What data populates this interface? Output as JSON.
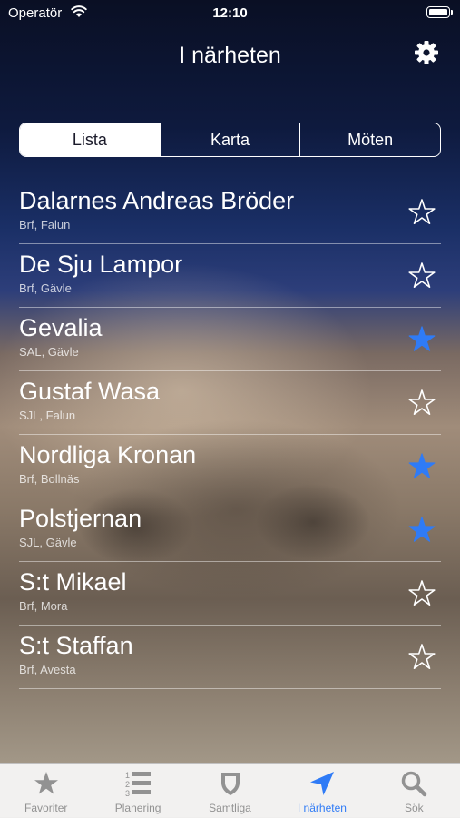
{
  "status_bar": {
    "carrier": "Operatör",
    "time": "12:10"
  },
  "nav": {
    "title": "I närheten",
    "settings_icon": "gear-icon"
  },
  "segments": [
    {
      "label": "Lista",
      "selected": true
    },
    {
      "label": "Karta",
      "selected": false
    },
    {
      "label": "Möten",
      "selected": false
    }
  ],
  "lodges": [
    {
      "name": "Dalarnes Andreas Bröder",
      "subtitle": "Brf, Falun",
      "favorite": false
    },
    {
      "name": "De Sju Lampor",
      "subtitle": "Brf, Gävle",
      "favorite": false
    },
    {
      "name": "Gevalia",
      "subtitle": "SAL, Gävle",
      "favorite": true
    },
    {
      "name": "Gustaf Wasa",
      "subtitle": "SJL, Falun",
      "favorite": false
    },
    {
      "name": "Nordliga Kronan",
      "subtitle": "Brf, Bollnäs",
      "favorite": true
    },
    {
      "name": "Polstjernan",
      "subtitle": "SJL, Gävle",
      "favorite": true
    },
    {
      "name": "S:t Mikael",
      "subtitle": "Brf, Mora",
      "favorite": false
    },
    {
      "name": "S:t Staffan",
      "subtitle": "Brf, Avesta",
      "favorite": false
    }
  ],
  "tabbar": {
    "tabs": [
      {
        "label": "Favoriter",
        "icon": "star-icon",
        "active": false
      },
      {
        "label": "Planering",
        "icon": "numbered-list-icon",
        "active": false
      },
      {
        "label": "Samtliga",
        "icon": "shield-icon",
        "active": false
      },
      {
        "label": "I närheten",
        "icon": "location-arrow-icon",
        "active": true
      },
      {
        "label": "Sök",
        "icon": "search-icon",
        "active": false
      }
    ]
  },
  "colors": {
    "accent": "#2f7bf6",
    "favorite_star": "#2f7bf6",
    "tab_inactive": "#929292"
  }
}
